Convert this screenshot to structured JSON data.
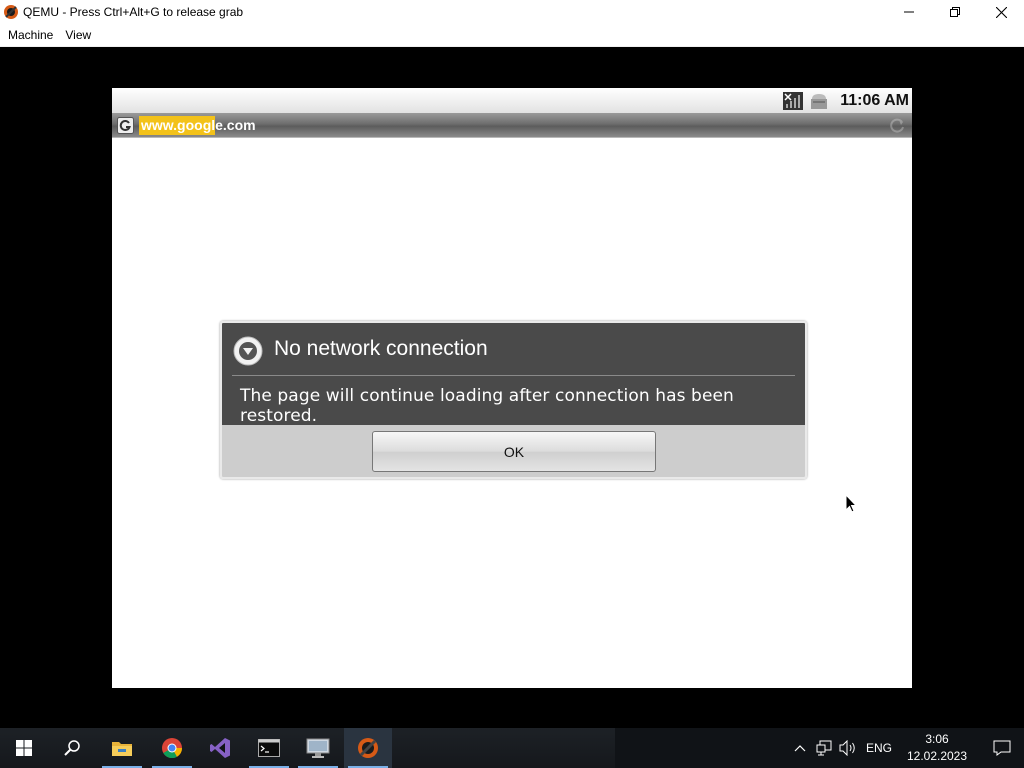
{
  "window": {
    "title": "QEMU - Press Ctrl+Alt+G to release grab",
    "app_icon": "qemu-icon",
    "controls": [
      "minimize",
      "restore",
      "close"
    ]
  },
  "menubar": {
    "items": [
      "Machine",
      "View"
    ]
  },
  "android": {
    "statusbar": {
      "icons": [
        "signal-off-icon",
        "sd-card-icon"
      ],
      "time": "11:06 AM"
    },
    "browser": {
      "url": "www.google.com",
      "url_highlight": "www.goog"
    },
    "dialog": {
      "title": "No network connection",
      "message": "The page will continue loading after connection has been restored.",
      "ok_label": "OK"
    }
  },
  "taskbar": {
    "apps": [
      "start-icon",
      "search-icon",
      "file-explorer-icon",
      "chrome-icon",
      "visual-studio-icon",
      "terminal-icon",
      "remote-desktop-icon",
      "qemu-icon"
    ],
    "active_app": "qemu-icon",
    "tray": {
      "language": "ENG",
      "time": "3:06",
      "date": "12.02.2023"
    }
  },
  "colors": {
    "dialog_header": "#4a4a4a",
    "dialog_footer": "#cdcdcd",
    "url_highlight": "#f3c21a",
    "taskbar": "#101317"
  }
}
